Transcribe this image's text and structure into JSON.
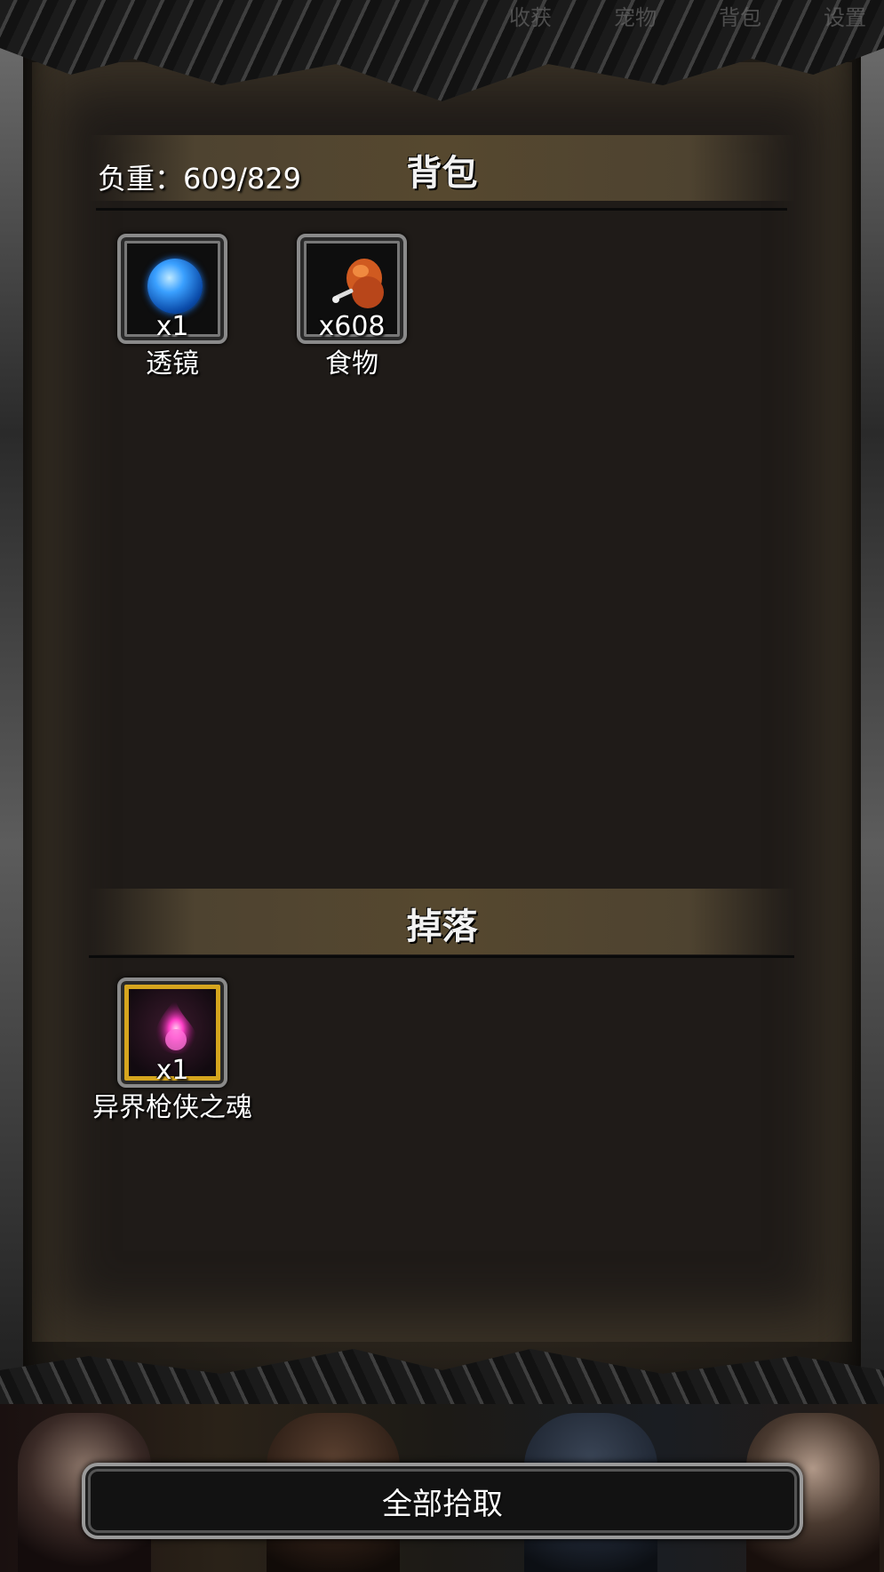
{
  "top_tabs": [
    "收获",
    "宠物",
    "背包",
    "设置"
  ],
  "bag": {
    "title": "背包",
    "weight_label": "负重：609/829",
    "items": [
      {
        "name": "透镜",
        "count": "x1",
        "icon": "blue-orb-icon"
      },
      {
        "name": "食物",
        "count": "x608",
        "icon": "meat-icon"
      }
    ]
  },
  "drops": {
    "title": "掉落",
    "items": [
      {
        "name": "异界枪侠之魂",
        "count": "x1",
        "icon": "pink-soul-icon",
        "rarity_color": "#d6a51e"
      }
    ]
  },
  "pickup_all": {
    "label": "全部拾取"
  }
}
